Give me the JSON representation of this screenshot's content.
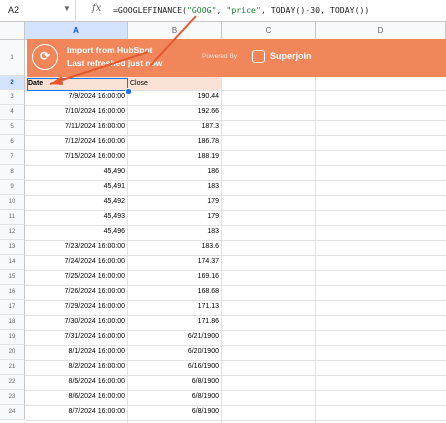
{
  "formula_bar": {
    "cell_ref": "A2",
    "dropdown_icon": "triangle-down-icon",
    "fx_label": "fx",
    "formula_prefix": "=GOOGLEFINANCE(",
    "formula_arg1": "\"GOOG\"",
    "formula_sep1": ", ",
    "formula_arg2": "\"price\"",
    "formula_suffix": ", TODAY()-30, TODAY())"
  },
  "columns": [
    "A",
    "B",
    "C",
    "D"
  ],
  "rows": [
    "1",
    "2",
    "3",
    "4",
    "5",
    "6",
    "7",
    "8",
    "9",
    "10",
    "11",
    "12",
    "13",
    "14",
    "15",
    "16",
    "17",
    "18",
    "19",
    "20",
    "21",
    "22",
    "23",
    "24"
  ],
  "banner": {
    "title": "Import from HubSpot",
    "subtitle": "Last refreshed just now",
    "powered_by": "Powered By",
    "brand": "Superjoin",
    "bg_color": "#f0865a"
  },
  "table": {
    "headers": [
      "Date",
      "Close"
    ],
    "data": [
      [
        "7/9/2024 16:00:00",
        "190.44"
      ],
      [
        "7/10/2024 16:00:00",
        "192.66"
      ],
      [
        "7/11/2024 16:00:00",
        "187.3"
      ],
      [
        "7/12/2024 16:00:00",
        "186.78"
      ],
      [
        "7/15/2024 16:00:00",
        "188.19"
      ],
      [
        "45,490",
        "186"
      ],
      [
        "45,491",
        "183"
      ],
      [
        "45,492",
        "179"
      ],
      [
        "45,493",
        "179"
      ],
      [
        "45,496",
        "183"
      ],
      [
        "7/23/2024 16:00:00",
        "183.6"
      ],
      [
        "7/24/2024 16:00:00",
        "174.37"
      ],
      [
        "7/25/2024 16:00:00",
        "169.16"
      ],
      [
        "7/26/2024 16:00:00",
        "168.68"
      ],
      [
        "7/29/2024 16:00:00",
        "171.13"
      ],
      [
        "7/30/2024 16:00:00",
        "171.86"
      ],
      [
        "7/31/2024 16:00:00",
        "6/21/1900"
      ],
      [
        "8/1/2024 16:00:00",
        "6/20/1900"
      ],
      [
        "8/2/2024 16:00:00",
        "6/16/1900"
      ],
      [
        "8/5/2024 16:00:00",
        "6/8/1900"
      ],
      [
        "8/6/2024 16:00:00",
        "6/8/1900"
      ],
      [
        "8/7/2024 16:00:00",
        "6/8/1900"
      ]
    ]
  },
  "colors": {
    "selection": "#1a73e8",
    "header_fill": "#fbe2d6",
    "arrow": "#e2582f"
  }
}
